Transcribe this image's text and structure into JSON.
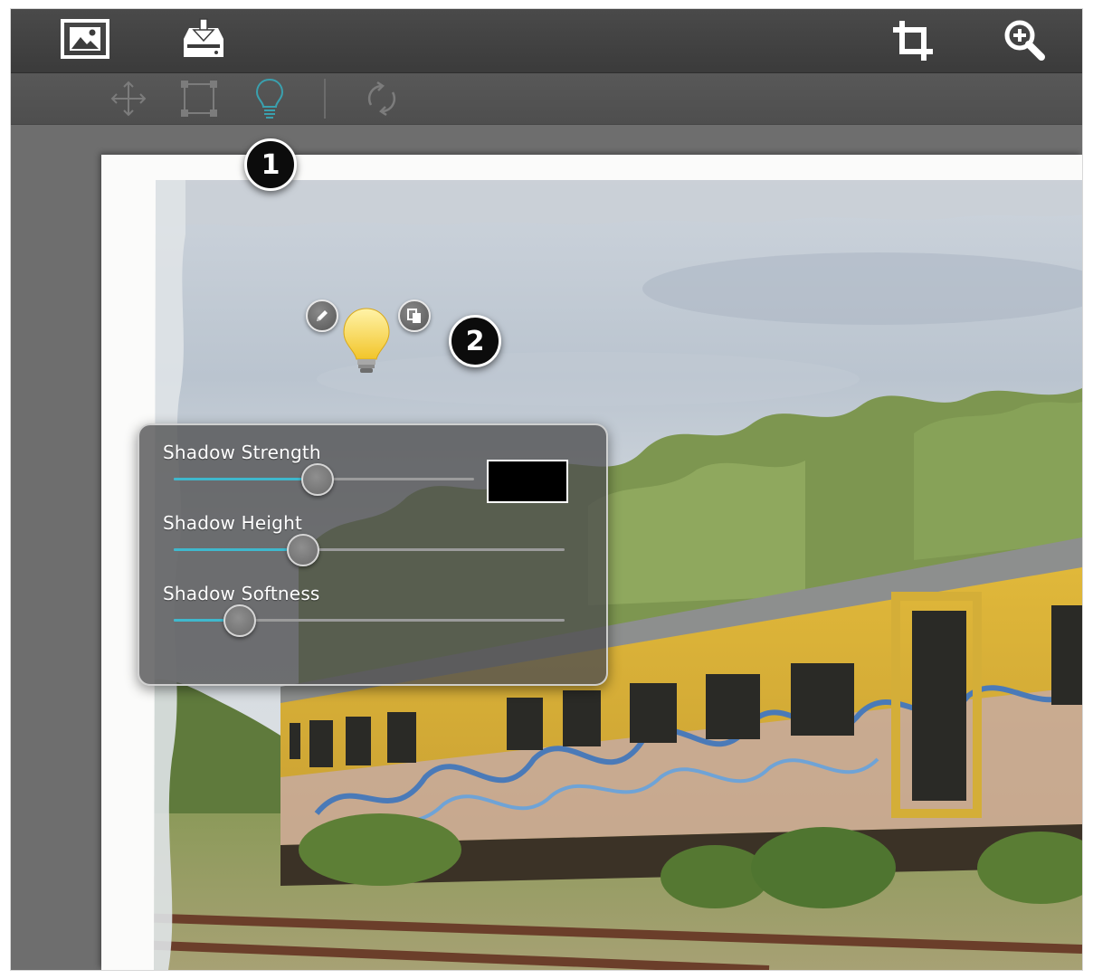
{
  "topbar": {
    "icons": [
      "image-icon",
      "download-tray-icon",
      "crop-icon",
      "zoom-in-icon"
    ]
  },
  "toolbar": {
    "icons": [
      "move-icon",
      "selection-rect-icon",
      "lightbulb-icon",
      "rotate-icon"
    ],
    "active_tool": "lightbulb-icon",
    "active_color": "#3aa0ae"
  },
  "callouts": {
    "badge_1": "1",
    "badge_2": "2"
  },
  "light_handle": {
    "icons": [
      "pencil-icon",
      "duplicate-icon",
      "lightbulb-icon"
    ]
  },
  "shadow_panel": {
    "strength": {
      "label": "Shadow Strength",
      "value": 0.48
    },
    "height": {
      "label": "Shadow Height",
      "value": 0.33
    },
    "softness": {
      "label": "Shadow Softness",
      "value": 0.17
    },
    "shadow_color": "#000000",
    "accent": "#3fb8cd"
  }
}
